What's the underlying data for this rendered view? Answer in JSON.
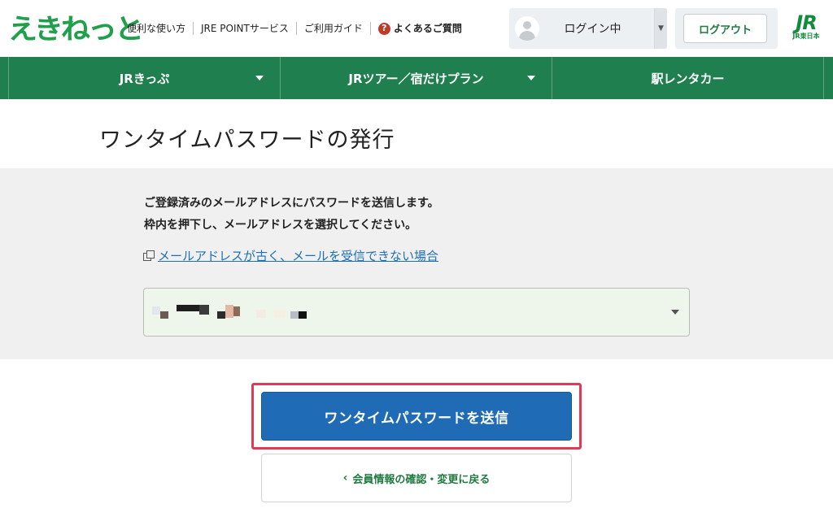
{
  "header": {
    "logo_text": "えきねっと",
    "links": [
      "便利な使い方",
      "JRE POINTサービス",
      "ご利用ガイド"
    ],
    "faq_label": "よくあるご質問",
    "login_status": "ログイン中",
    "logout_label": "ログアウト",
    "jr_logo": "JR",
    "jr_logo_sub": "JR東日本"
  },
  "nav": {
    "items": [
      {
        "label": "JRきっぷ",
        "has_dropdown": true
      },
      {
        "label": "JRツアー／宿だけプラン",
        "has_dropdown": true
      },
      {
        "label": "駅レンタカー",
        "has_dropdown": false
      }
    ]
  },
  "main": {
    "title": "ワンタイムパスワードの発行",
    "instruction_line1": "ご登録済みのメールアドレスにパスワードを送信します。",
    "instruction_line2": "枠内を押下し、メールアドレスを選択してください。",
    "help_link": "メールアドレスが古く、メールを受信できない場合",
    "email_select_value": "",
    "send_button": "ワンタイムパスワードを送信",
    "back_button": "会員情報の確認・変更に戻る"
  },
  "colors": {
    "brand_green": "#1f7f4e",
    "primary_blue": "#1f6bb5",
    "highlight_red": "#e03a57",
    "panel_gray": "#f0f0f0"
  }
}
